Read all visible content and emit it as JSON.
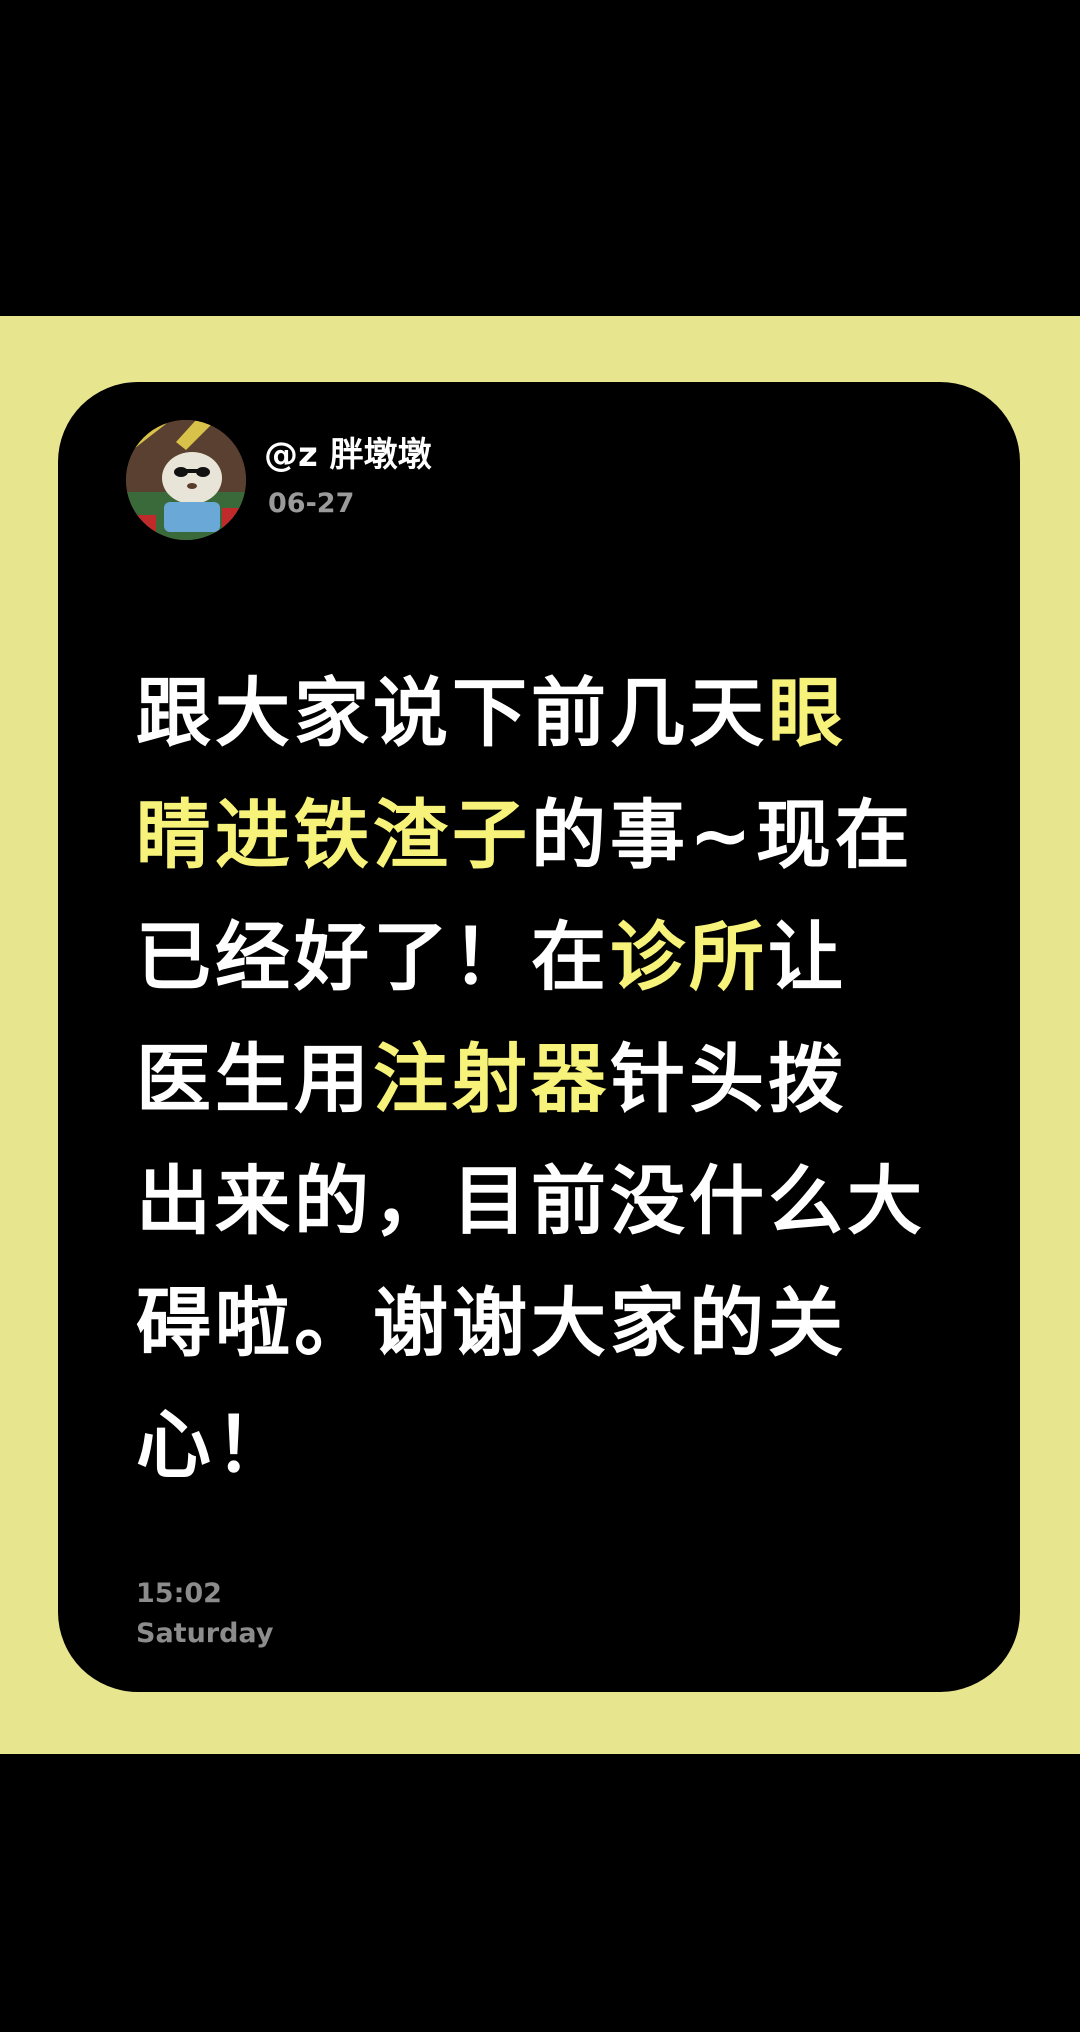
{
  "post": {
    "username": "@z 胖墩墩",
    "date": "06-27",
    "content_segments": [
      {
        "text": "跟大家说下前几天",
        "highlight": false
      },
      {
        "text": "眼睛进铁渣子",
        "highlight": true
      },
      {
        "text": "的事~现在已经好了！在",
        "highlight": false
      },
      {
        "text": "诊所",
        "highlight": true
      },
      {
        "text": "让医生用",
        "highlight": false
      },
      {
        "text": "注射器",
        "highlight": true
      },
      {
        "text": "针头拨出来的，目前没什么大碍啦。谢谢大家的关心！",
        "highlight": false
      }
    ],
    "time": "15:02",
    "weekday": "Saturday"
  },
  "colors": {
    "background": "#000000",
    "band": "#e8e58f",
    "card": "#000000",
    "text": "#ffffff",
    "highlight": "#f7f37a",
    "meta": "#8c8c8c"
  },
  "icons": {
    "avatar": "avatar-image"
  }
}
